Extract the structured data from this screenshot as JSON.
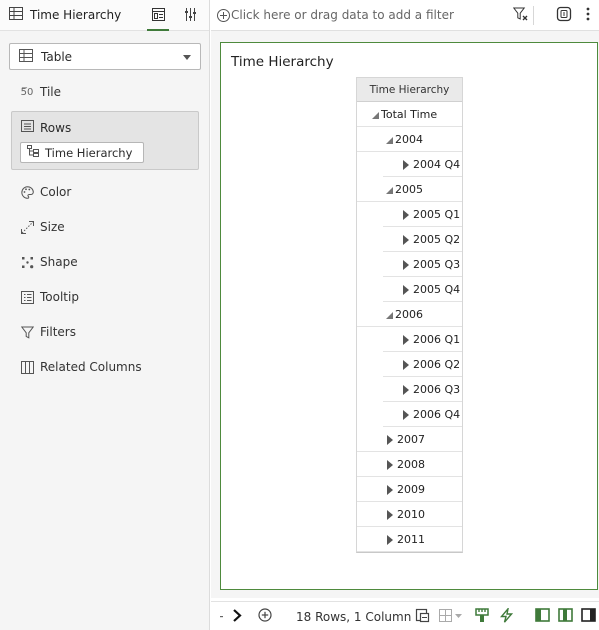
{
  "left_panel": {
    "title": "Time Hierarchy",
    "viz_type": "Table",
    "grammar": {
      "tile": "Tile",
      "rows": "Rows",
      "rows_item": "Time Hierarchy",
      "color": "Color",
      "size": "Size",
      "shape": "Shape",
      "tooltip": "Tooltip",
      "filters": "Filters",
      "related_columns": "Related Columns"
    }
  },
  "filter_bar": {
    "placeholder": "Click here or drag data to add a filter"
  },
  "canvas": {
    "viz_title": "Time Hierarchy",
    "table_header": "Time Hierarchy",
    "rows": [
      {
        "label": "Total Time",
        "level": 0,
        "state": "expanded"
      },
      {
        "label": "2004",
        "level": 1,
        "state": "expanded"
      },
      {
        "label": "2004 Q4",
        "level": 2,
        "state": "collapsed"
      },
      {
        "label": "2005",
        "level": 1,
        "state": "expanded"
      },
      {
        "label": "2005 Q1",
        "level": 2,
        "state": "collapsed"
      },
      {
        "label": "2005 Q2",
        "level": 2,
        "state": "collapsed"
      },
      {
        "label": "2005 Q3",
        "level": 2,
        "state": "collapsed"
      },
      {
        "label": "2005 Q4",
        "level": 2,
        "state": "collapsed"
      },
      {
        "label": "2006",
        "level": 1,
        "state": "expanded"
      },
      {
        "label": "2006 Q1",
        "level": 2,
        "state": "collapsed"
      },
      {
        "label": "2006 Q2",
        "level": 2,
        "state": "collapsed"
      },
      {
        "label": "2006 Q3",
        "level": 2,
        "state": "collapsed"
      },
      {
        "label": "2006 Q4",
        "level": 2,
        "state": "collapsed"
      },
      {
        "label": "2007",
        "level": 1,
        "state": "collapsed"
      },
      {
        "label": "2008",
        "level": 1,
        "state": "collapsed"
      },
      {
        "label": "2009",
        "level": 1,
        "state": "collapsed"
      },
      {
        "label": "2010",
        "level": 1,
        "state": "collapsed"
      },
      {
        "label": "2011",
        "level": 1,
        "state": "collapsed"
      }
    ]
  },
  "status_bar": {
    "row_count": "18 Rows, 1 Column"
  },
  "colors": {
    "accent": "#3f7a3a",
    "selection_border": "#4e8a3d",
    "panel_bg": "#f5f5f5"
  }
}
